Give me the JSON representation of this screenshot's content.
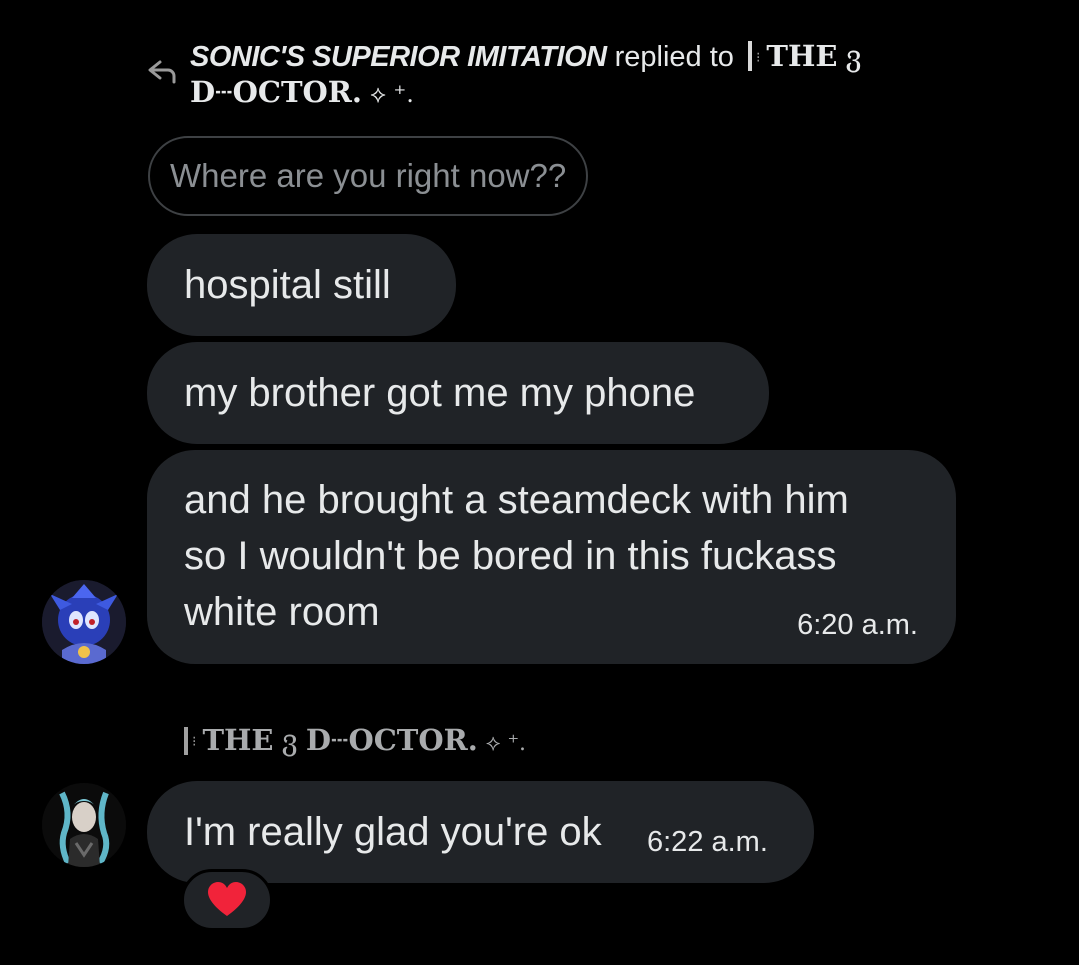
{
  "reply_header": {
    "author": "SONIC'S SUPERIOR IMITATION",
    "verb": "replied to",
    "target_part1": "THE",
    "target_mark": "ვ",
    "target_part2": "D┄OCTOR.",
    "target_suffix": "⟡ ⁺."
  },
  "quoted_message": "Where are you right now??",
  "messages": [
    {
      "text": "hospital still"
    },
    {
      "text": "my brother got me my phone"
    },
    {
      "lines": [
        "and he brought a steamdeck with him",
        "so I wouldn't be bored in this fuckass",
        "white room"
      ],
      "time": "6:20 a.m."
    }
  ],
  "sender_name": {
    "part1": "THE",
    "mark": "ვ",
    "part2": "D┄OCTOR.",
    "suffix": "⟡ ⁺."
  },
  "reply_message": {
    "text": "I'm really glad you're ok",
    "time": "6:22 a.m."
  },
  "reaction": {
    "icon": "heart-icon",
    "color": "#f91880"
  },
  "colors": {
    "background": "#000000",
    "bubble": "#202327",
    "text": "#e7e9ea",
    "muted": "#8b8f93"
  }
}
